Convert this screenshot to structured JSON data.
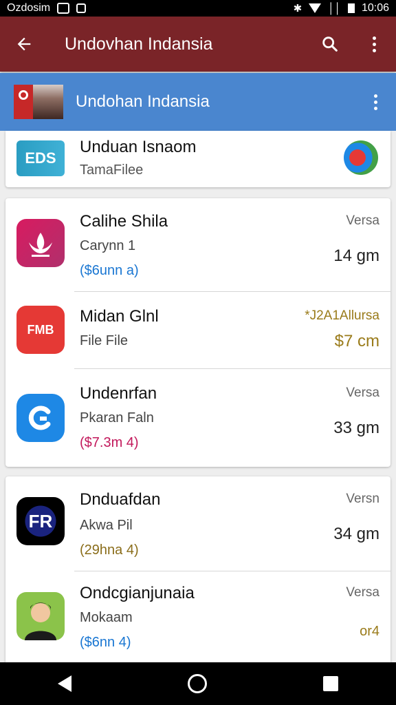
{
  "status_bar": {
    "carrier": "Ozdosim",
    "time": "10:06"
  },
  "app_bar": {
    "title": "Undovhan Indansia"
  },
  "sub_bar": {
    "title": "Undohan Indansia"
  },
  "featured": {
    "name": "Unduan Isnaom",
    "subtitle": "TamaFilee",
    "icon_text": "EDS"
  },
  "cards": [
    {
      "items": [
        {
          "name": "Calihe Shila",
          "sub": "Carynn 1",
          "price": "($6unn a)",
          "version": "Versa",
          "size": "14 gm",
          "price_color": "#1976d2",
          "icon": "lotus-icon"
        },
        {
          "name": "Midan Glnl",
          "sub": "File File",
          "price": "",
          "version": "*J2A1Allursa",
          "size": "$7 cm",
          "version_color": "#9a7b1a",
          "size_color": "#9a7b1a",
          "icon": "fmb-icon",
          "icon_text": "FMB"
        },
        {
          "name": "Undenrfan",
          "sub": "Pkaran Faln",
          "price": "($7.3m 4)",
          "version": "Versa",
          "size": "33 gm",
          "price_color": "#c2185b",
          "icon": "g-logo-icon"
        }
      ]
    },
    {
      "items": [
        {
          "name": "Dnduafdan",
          "sub": "Akwa Pil",
          "price": "(29hna 4)",
          "version": "Versn",
          "size": "34 gm",
          "price_color": "#8a6d1a",
          "icon": "album-art-icon",
          "icon_text": "FR"
        },
        {
          "name": "Ondcgianjunaia",
          "sub": "Mokaam",
          "price": "($6nn 4)",
          "version": "Versa",
          "size": "or4",
          "price_color": "#1976d2",
          "size_color": "#9a7b1a",
          "icon": "person-avatar-icon"
        }
      ]
    }
  ],
  "colors": {
    "app_bar": "#7a2428",
    "sub_bar": "#4a86cf"
  }
}
